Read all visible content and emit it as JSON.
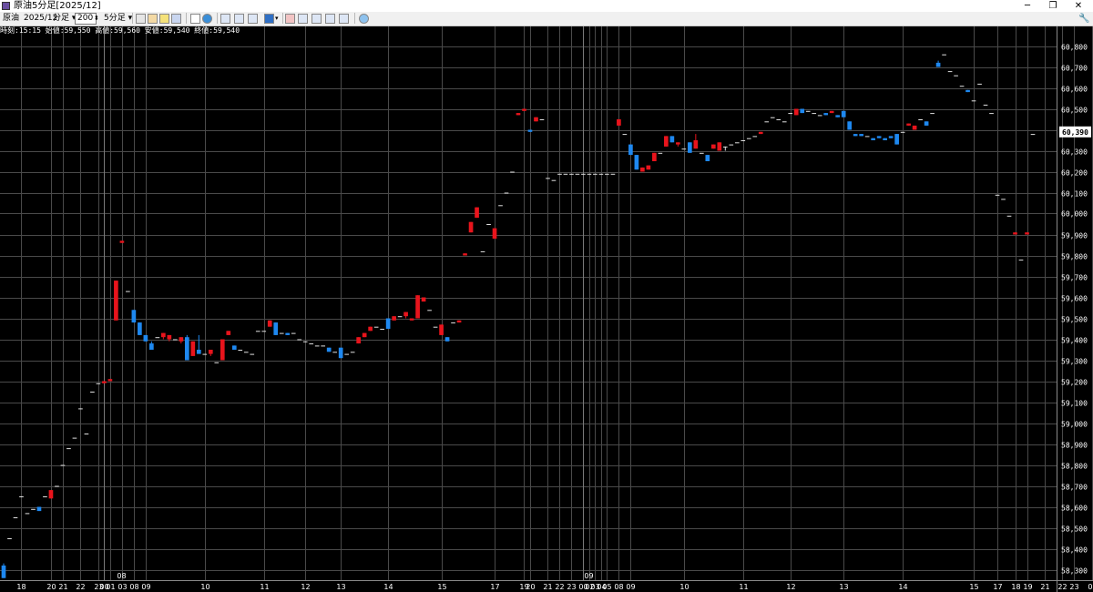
{
  "window": {
    "title": "原油5分足[2025/12]",
    "controls": [
      "─",
      "❐",
      "✕"
    ]
  },
  "toolbar": {
    "symbol": "原油",
    "contract": "2025/12",
    "period_type": "分足",
    "bar_count": "200",
    "interval": "5分足"
  },
  "info_line": "時刻:15:15 始値:59,550 高値:59,560 安値:59,540 終値:59,540",
  "chart_data": {
    "type": "candlestick",
    "y_range": [
      58250,
      60850
    ],
    "y_ticks": [
      58300,
      58400,
      58500,
      58600,
      58700,
      58800,
      58900,
      59000,
      59100,
      59200,
      59300,
      59400,
      59500,
      59600,
      59700,
      59800,
      59900,
      60000,
      60100,
      60200,
      60300,
      60400,
      60500,
      60600,
      60700,
      60800
    ],
    "y_tick_labels": [
      "58,300",
      "58,400",
      "58,500",
      "58,600",
      "58,700",
      "58,800",
      "58,900",
      "59,000",
      "59,100",
      "59,200",
      "59,300",
      "59,400",
      "59,500",
      "59,600",
      "59,700",
      "59,800",
      "59,900",
      "60,000",
      "60,100",
      "60,200",
      "60,300",
      "60,400",
      "60,500",
      "60,600",
      "60,700",
      "60,800"
    ],
    "current_price": "60,390",
    "current_value": 60390,
    "x_labels": [
      {
        "i": 3,
        "label": "18"
      },
      {
        "i": 8,
        "label": "20"
      },
      {
        "i": 10,
        "label": "21"
      },
      {
        "i": 13,
        "label": "22"
      },
      {
        "i": 16,
        "label": "23"
      },
      {
        "i": 17,
        "label": "00"
      },
      {
        "i": 18,
        "label": "01"
      },
      {
        "i": 20,
        "label": "03"
      },
      {
        "i": 22,
        "label": "08"
      },
      {
        "i": 24,
        "label": "09"
      },
      {
        "i": 34,
        "label": "10"
      },
      {
        "i": 44,
        "label": "11"
      },
      {
        "i": 51,
        "label": "12"
      },
      {
        "i": 57,
        "label": "13"
      },
      {
        "i": 65,
        "label": "14"
      },
      {
        "i": 74,
        "label": "15"
      },
      {
        "i": 83,
        "label": "17"
      },
      {
        "i": 88,
        "label": "19"
      },
      {
        "i": 89,
        "label": "20"
      },
      {
        "i": 92,
        "label": "21"
      },
      {
        "i": 94,
        "label": "22"
      },
      {
        "i": 96,
        "label": "23"
      },
      {
        "i": 98,
        "label": "00"
      },
      {
        "i": 99,
        "label": "02"
      },
      {
        "i": 100,
        "label": "03"
      },
      {
        "i": 101,
        "label": "04"
      },
      {
        "i": 102,
        "label": "05"
      },
      {
        "i": 104,
        "label": "08"
      },
      {
        "i": 106,
        "label": "09"
      },
      {
        "i": 115,
        "label": "10"
      },
      {
        "i": 125,
        "label": "11"
      },
      {
        "i": 133,
        "label": "12"
      },
      {
        "i": 142,
        "label": "13"
      },
      {
        "i": 152,
        "label": "14"
      },
      {
        "i": 164,
        "label": "15"
      },
      {
        "i": 168,
        "label": "17"
      },
      {
        "i": 171,
        "label": "18"
      },
      {
        "i": 173,
        "label": "19"
      },
      {
        "i": 176,
        "label": "21"
      },
      {
        "i": 179,
        "label": "22"
      },
      {
        "i": 181,
        "label": "23"
      },
      {
        "i": 184,
        "label": "00"
      }
    ],
    "date_markers": [
      {
        "i": 19,
        "label": "08"
      },
      {
        "i": 98,
        "label": "09"
      }
    ],
    "day_separators": [
      17,
      98
    ],
    "colors": {
      "up": "#e8141c",
      "down": "#1e88f0",
      "doji": "#e0e0e0",
      "grid": "#4a4a4a",
      "text": "#ffffff"
    },
    "candles": [
      [
        58320,
        58330,
        58260,
        58260
      ],
      [
        58450,
        58450,
        58450,
        58450
      ],
      [
        58550,
        58550,
        58550,
        58550
      ],
      [
        58650,
        58650,
        58650,
        58650
      ],
      [
        58570,
        58570,
        58570,
        58570
      ],
      [
        58590,
        58590,
        58590,
        58590
      ],
      [
        58600,
        58590,
        58580,
        58580
      ],
      [
        58650,
        58650,
        58650,
        58650
      ],
      [
        58640,
        58680,
        58640,
        58680
      ],
      [
        58700,
        58700,
        58700,
        58700
      ],
      [
        58800,
        58800,
        58800,
        58800
      ],
      [
        58880,
        58880,
        58880,
        58880
      ],
      [
        58930,
        58930,
        58930,
        58930
      ],
      [
        59070,
        59070,
        59070,
        59070
      ],
      [
        58950,
        58950,
        58950,
        58950
      ],
      [
        59150,
        59150,
        59150,
        59150
      ],
      [
        59190,
        59190,
        59190,
        59190
      ],
      [
        59190,
        59200,
        59190,
        59200
      ],
      [
        59200,
        59210,
        59200,
        59210
      ],
      [
        59490,
        59680,
        59490,
        59680
      ],
      [
        59860,
        59870,
        59860,
        59870
      ],
      [
        59630,
        59630,
        59630,
        59630
      ],
      [
        59540,
        59540,
        59480,
        59480
      ],
      [
        59480,
        59480,
        59420,
        59420
      ],
      [
        59420,
        59420,
        59390,
        59390
      ],
      [
        59380,
        59390,
        59350,
        59350
      ],
      [
        59410,
        59410,
        59410,
        59410
      ],
      [
        59410,
        59430,
        59400,
        59430
      ],
      [
        59400,
        59420,
        59390,
        59420
      ],
      [
        59400,
        59400,
        59400,
        59400
      ],
      [
        59390,
        59410,
        59380,
        59410
      ],
      [
        59410,
        59420,
        59300,
        59300
      ],
      [
        59320,
        59390,
        59320,
        59390
      ],
      [
        59350,
        59420,
        59330,
        59330
      ],
      [
        59330,
        59330,
        59330,
        59330
      ],
      [
        59330,
        59350,
        59320,
        59350
      ],
      [
        59290,
        59290,
        59290,
        59290
      ],
      [
        59300,
        59400,
        59300,
        59400
      ],
      [
        59420,
        59440,
        59420,
        59440
      ],
      [
        59370,
        59370,
        59350,
        59350
      ],
      [
        59350,
        59350,
        59350,
        59350
      ],
      [
        59340,
        59340,
        59340,
        59340
      ],
      [
        59330,
        59330,
        59330,
        59330
      ],
      [
        59440,
        59440,
        59440,
        59440
      ],
      [
        59440,
        59440,
        59440,
        59440
      ],
      [
        59460,
        59490,
        59460,
        59490
      ],
      [
        59480,
        59480,
        59420,
        59420
      ],
      [
        59430,
        59430,
        59430,
        59430
      ],
      [
        59430,
        59430,
        59420,
        59420
      ],
      [
        59430,
        59430,
        59430,
        59430
      ],
      [
        59400,
        59400,
        59400,
        59400
      ],
      [
        59390,
        59390,
        59390,
        59390
      ],
      [
        59380,
        59380,
        59380,
        59380
      ],
      [
        59370,
        59370,
        59370,
        59370
      ],
      [
        59370,
        59370,
        59370,
        59370
      ],
      [
        59360,
        59360,
        59340,
        59340
      ],
      [
        59340,
        59340,
        59340,
        59340
      ],
      [
        59360,
        59360,
        59310,
        59310
      ],
      [
        59330,
        59330,
        59330,
        59330
      ],
      [
        59340,
        59340,
        59340,
        59340
      ],
      [
        59380,
        59410,
        59380,
        59410
      ],
      [
        59410,
        59430,
        59410,
        59430
      ],
      [
        59440,
        59460,
        59440,
        59460
      ],
      [
        59460,
        59460,
        59460,
        59460
      ],
      [
        59450,
        59450,
        59450,
        59450
      ],
      [
        59500,
        59500,
        59450,
        59450
      ],
      [
        59490,
        59510,
        59490,
        59510
      ],
      [
        59510,
        59510,
        59510,
        59510
      ],
      [
        59510,
        59530,
        59500,
        59530
      ],
      [
        59490,
        59500,
        59490,
        59500
      ],
      [
        59500,
        59610,
        59500,
        59610
      ],
      [
        59580,
        59600,
        59580,
        59600
      ],
      [
        59540,
        59540,
        59540,
        59540
      ],
      [
        59460,
        59460,
        59460,
        59460
      ],
      [
        59420,
        59470,
        59420,
        59470
      ],
      [
        59410,
        59410,
        59390,
        59390
      ],
      [
        59480,
        59480,
        59480,
        59480
      ],
      [
        59480,
        59490,
        59480,
        59490
      ],
      [
        59800,
        59810,
        59800,
        59810
      ],
      [
        59910,
        59960,
        59910,
        59960
      ],
      [
        59980,
        60030,
        59980,
        60030
      ],
      [
        59820,
        59820,
        59820,
        59820
      ],
      [
        59950,
        59950,
        59950,
        59950
      ],
      [
        59880,
        59930,
        59880,
        59930
      ],
      [
        60040,
        60040,
        60040,
        60040
      ],
      [
        60100,
        60100,
        60100,
        60100
      ],
      [
        60200,
        60200,
        60200,
        60200
      ],
      [
        60470,
        60480,
        60470,
        60480
      ],
      [
        60490,
        60500,
        60490,
        60500
      ],
      [
        60400,
        60400,
        60390,
        60390
      ],
      [
        60440,
        60460,
        60440,
        60460
      ],
      [
        60450,
        60450,
        60450,
        60450
      ],
      [
        60170,
        60170,
        60170,
        60170
      ],
      [
        60160,
        60160,
        60160,
        60160
      ],
      [
        60190,
        60190,
        60190,
        60190
      ],
      [
        60190,
        60190,
        60190,
        60190
      ],
      [
        60190,
        60190,
        60190,
        60190
      ],
      [
        60190,
        60190,
        60190,
        60190
      ],
      [
        60190,
        60190,
        60190,
        60190
      ],
      [
        60190,
        60190,
        60190,
        60190
      ],
      [
        60190,
        60190,
        60190,
        60190
      ],
      [
        60190,
        60190,
        60190,
        60190
      ],
      [
        60190,
        60190,
        60190,
        60190
      ],
      [
        60190,
        60190,
        60190,
        60190
      ],
      [
        60420,
        60450,
        60420,
        60450
      ],
      [
        60380,
        60380,
        60380,
        60380
      ],
      [
        60330,
        60330,
        60280,
        60280
      ],
      [
        60280,
        60280,
        60210,
        60210
      ],
      [
        60200,
        60220,
        60200,
        60220
      ],
      [
        60210,
        60230,
        60210,
        60230
      ],
      [
        60250,
        60290,
        60250,
        60290
      ],
      [
        60290,
        60290,
        60290,
        60290
      ],
      [
        60320,
        60370,
        60320,
        60370
      ],
      [
        60370,
        60370,
        60340,
        60340
      ],
      [
        60330,
        60340,
        60320,
        60340
      ],
      [
        60310,
        60310,
        60310,
        60310
      ],
      [
        60340,
        60340,
        60290,
        60290
      ],
      [
        60310,
        60380,
        60310,
        60350
      ],
      [
        60290,
        60290,
        60290,
        60290
      ],
      [
        60280,
        60280,
        60250,
        60250
      ],
      [
        60310,
        60330,
        60310,
        60330
      ],
      [
        60300,
        60340,
        60300,
        60340
      ],
      [
        60320,
        60320,
        60300,
        60320
      ],
      [
        60330,
        60330,
        60330,
        60330
      ],
      [
        60340,
        60340,
        60340,
        60340
      ],
      [
        60350,
        60350,
        60350,
        60350
      ],
      [
        60360,
        60360,
        60360,
        60360
      ],
      [
        60370,
        60370,
        60370,
        60370
      ],
      [
        60380,
        60390,
        60380,
        60390
      ],
      [
        60440,
        60440,
        60440,
        60440
      ],
      [
        60460,
        60460,
        60460,
        60460
      ],
      [
        60450,
        60450,
        60450,
        60450
      ],
      [
        60440,
        60440,
        60440,
        60440
      ],
      [
        60480,
        60480,
        60480,
        60480
      ],
      [
        60470,
        60500,
        60470,
        60500
      ],
      [
        60500,
        60500,
        60480,
        60480
      ],
      [
        60490,
        60490,
        60490,
        60490
      ],
      [
        60480,
        60480,
        60480,
        60480
      ],
      [
        60470,
        60470,
        60470,
        60470
      ],
      [
        60480,
        60480,
        60470,
        60470
      ],
      [
        60480,
        60490,
        60480,
        60490
      ],
      [
        60470,
        60470,
        60460,
        60460
      ],
      [
        60490,
        60490,
        60460,
        60460
      ],
      [
        60440,
        60440,
        60400,
        60400
      ],
      [
        60380,
        60380,
        60370,
        60370
      ],
      [
        60380,
        60380,
        60370,
        60370
      ],
      [
        60370,
        60370,
        60370,
        60370
      ],
      [
        60360,
        60360,
        60350,
        60350
      ],
      [
        60370,
        60370,
        60360,
        60360
      ],
      [
        60360,
        60360,
        60350,
        60350
      ],
      [
        60370,
        60370,
        60360,
        60360
      ],
      [
        60380,
        60380,
        60330,
        60330
      ],
      [
        60390,
        60390,
        60390,
        60390
      ],
      [
        60420,
        60430,
        60420,
        60430
      ],
      [
        60400,
        60420,
        60400,
        60420
      ],
      [
        60450,
        60450,
        60450,
        60450
      ],
      [
        60440,
        60440,
        60420,
        60420
      ],
      [
        60480,
        60480,
        60480,
        60480
      ],
      [
        60720,
        60730,
        60700,
        60700
      ],
      [
        60760,
        60760,
        60760,
        60760
      ],
      [
        60680,
        60680,
        60680,
        60680
      ],
      [
        60660,
        60660,
        60660,
        60660
      ],
      [
        60610,
        60610,
        60610,
        60610
      ],
      [
        60590,
        60590,
        60580,
        60580
      ],
      [
        60540,
        60540,
        60540,
        60540
      ],
      [
        60620,
        60620,
        60620,
        60620
      ],
      [
        60520,
        60520,
        60520,
        60520
      ],
      [
        60480,
        60480,
        60480,
        60480
      ],
      [
        60090,
        60090,
        60090,
        60090
      ],
      [
        60070,
        60070,
        60070,
        60070
      ],
      [
        59990,
        59990,
        59990,
        59990
      ],
      [
        59900,
        59910,
        59900,
        59910
      ],
      [
        59780,
        59780,
        59780,
        59780
      ],
      [
        59900,
        59910,
        59900,
        59910
      ],
      [
        60380,
        60380,
        60380,
        60380
      ]
    ]
  }
}
